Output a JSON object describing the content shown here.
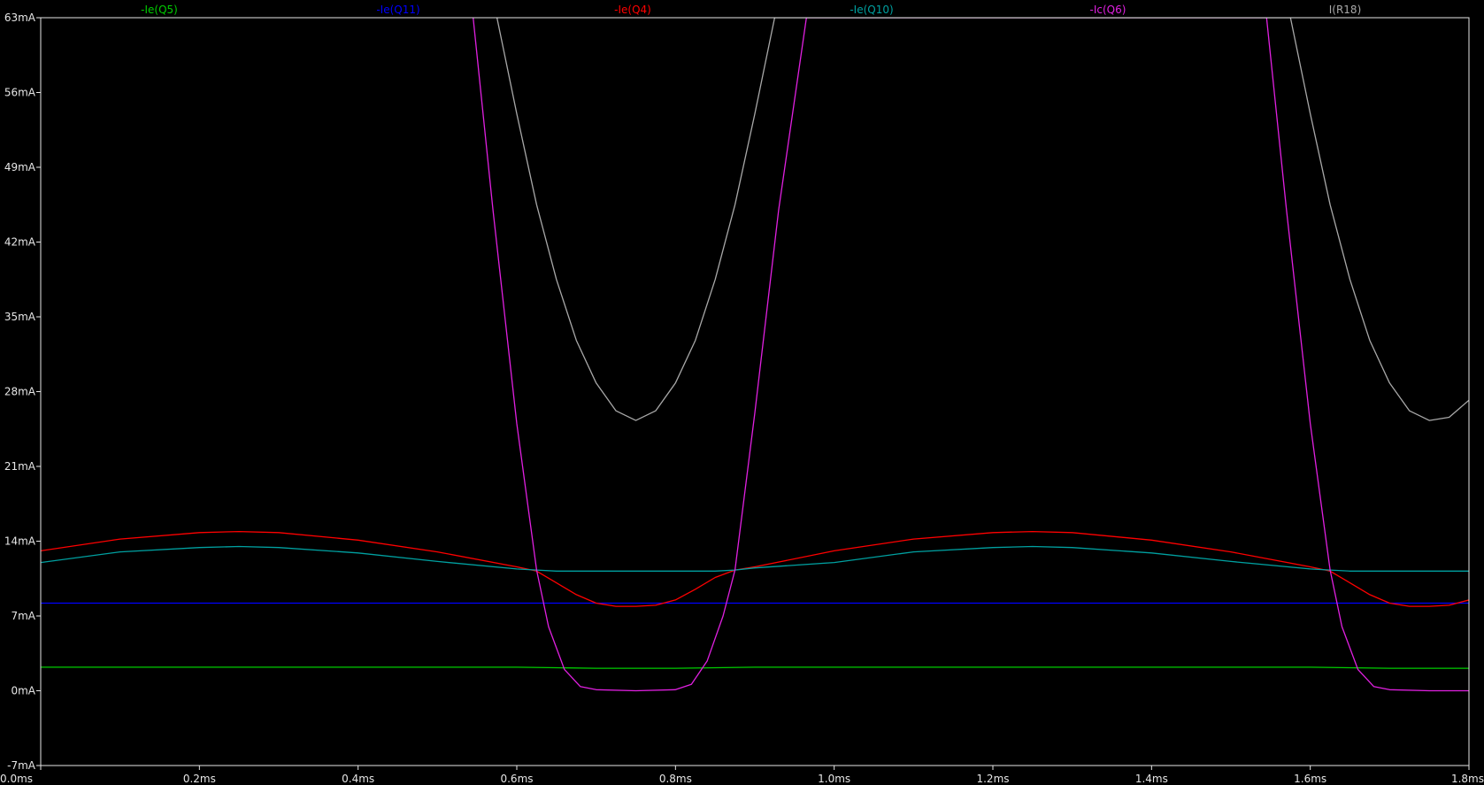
{
  "chart_data": {
    "type": "line",
    "title": "",
    "xlabel": "",
    "ylabel": "",
    "xlim": [
      0,
      1.8
    ],
    "ylim": [
      -7,
      63
    ],
    "x_ticks": [
      "0.0ms",
      "0.2ms",
      "0.4ms",
      "0.6ms",
      "0.8ms",
      "1.0ms",
      "1.2ms",
      "1.4ms",
      "1.6ms",
      "1.8ms"
    ],
    "y_ticks": [
      "63mA",
      "56mA",
      "49mA",
      "42mA",
      "35mA",
      "28mA",
      "21mA",
      "14mA",
      "7mA",
      "0mA",
      "-7mA"
    ],
    "grid": false,
    "background": "#000000",
    "axis_color": "#e6e6e6",
    "series": [
      {
        "name": "-Ie(Q5)",
        "color": "#00cc00",
        "x": [
          0,
          0.6,
          0.65,
          0.7,
          0.8,
          0.85,
          0.9,
          1.6,
          1.65,
          1.7,
          1.8
        ],
        "y": [
          2.2,
          2.2,
          2.15,
          2.1,
          2.1,
          2.15,
          2.2,
          2.2,
          2.15,
          2.1,
          2.1
        ]
      },
      {
        "name": "-Ie(Q11)",
        "color": "#0000ff",
        "x": [
          0,
          1.8
        ],
        "y": [
          8.2,
          8.2
        ]
      },
      {
        "name": "-Ie(Q4)",
        "color": "#ff0000",
        "x": [
          0,
          0.1,
          0.2,
          0.25,
          0.3,
          0.4,
          0.5,
          0.6,
          0.625,
          0.65,
          0.675,
          0.7,
          0.725,
          0.75,
          0.775,
          0.8,
          0.825,
          0.85,
          0.875,
          0.9,
          1.0,
          1.1,
          1.2,
          1.25,
          1.3,
          1.4,
          1.5,
          1.6,
          1.625,
          1.65,
          1.675,
          1.7,
          1.725,
          1.75,
          1.775,
          1.8
        ],
        "y": [
          13.1,
          14.2,
          14.8,
          14.9,
          14.8,
          14.1,
          13.0,
          11.6,
          11.2,
          10.1,
          9.0,
          8.2,
          7.9,
          7.9,
          8.0,
          8.5,
          9.5,
          10.6,
          11.3,
          11.6,
          13.1,
          14.2,
          14.8,
          14.9,
          14.8,
          14.1,
          13.0,
          11.6,
          11.2,
          10.1,
          9.0,
          8.2,
          7.9,
          7.9,
          8.0,
          8.5
        ]
      },
      {
        "name": "-Ie(Q10)",
        "color": "#00a0a0",
        "x": [
          0,
          0.1,
          0.2,
          0.25,
          0.3,
          0.4,
          0.5,
          0.6,
          0.625,
          0.65,
          0.7,
          0.75,
          0.8,
          0.85,
          0.875,
          0.9,
          1.0,
          1.1,
          1.2,
          1.25,
          1.3,
          1.4,
          1.5,
          1.6,
          1.625,
          1.65,
          1.7,
          1.75,
          1.8
        ],
        "y": [
          12.0,
          13.0,
          13.4,
          13.5,
          13.4,
          12.9,
          12.1,
          11.4,
          11.3,
          11.2,
          11.2,
          11.2,
          11.2,
          11.2,
          11.3,
          11.5,
          12.0,
          13.0,
          13.4,
          13.5,
          13.4,
          12.9,
          12.1,
          11.4,
          11.3,
          11.2,
          11.2,
          11.2,
          11.2
        ]
      },
      {
        "name": "-Ic(Q6)",
        "color": "#e020e0",
        "x": [
          0.545,
          0.57,
          0.6,
          0.625,
          0.64,
          0.66,
          0.68,
          0.7,
          0.75,
          0.8,
          0.82,
          0.84,
          0.86,
          0.875,
          0.9,
          0.93,
          0.965,
          1.545,
          1.57,
          1.6,
          1.625,
          1.64,
          1.66,
          1.68,
          1.7,
          1.75,
          1.8
        ],
        "y": [
          63,
          45,
          25,
          11.3,
          6.0,
          2.0,
          0.4,
          0.1,
          0.0,
          0.1,
          0.6,
          2.8,
          7.0,
          11.3,
          26.0,
          45.0,
          63,
          63,
          45,
          25,
          11.3,
          6.0,
          2.0,
          0.4,
          0.1,
          0.0,
          0.0
        ]
      },
      {
        "name": "I(R18)",
        "color": "#a8a8a8",
        "x": [
          0.575,
          0.6,
          0.625,
          0.65,
          0.675,
          0.7,
          0.725,
          0.75,
          0.775,
          0.8,
          0.825,
          0.85,
          0.875,
          0.9,
          0.925,
          1.575,
          1.6,
          1.625,
          1.65,
          1.675,
          1.7,
          1.725,
          1.75,
          1.775,
          1.8
        ],
        "y": [
          63,
          54.0,
          45.5,
          38.5,
          32.8,
          28.8,
          26.2,
          25.3,
          26.2,
          28.8,
          32.8,
          38.5,
          45.5,
          54.0,
          63,
          63,
          54.0,
          45.5,
          38.5,
          32.8,
          28.8,
          26.2,
          25.3,
          25.6,
          27.2
        ]
      }
    ]
  }
}
